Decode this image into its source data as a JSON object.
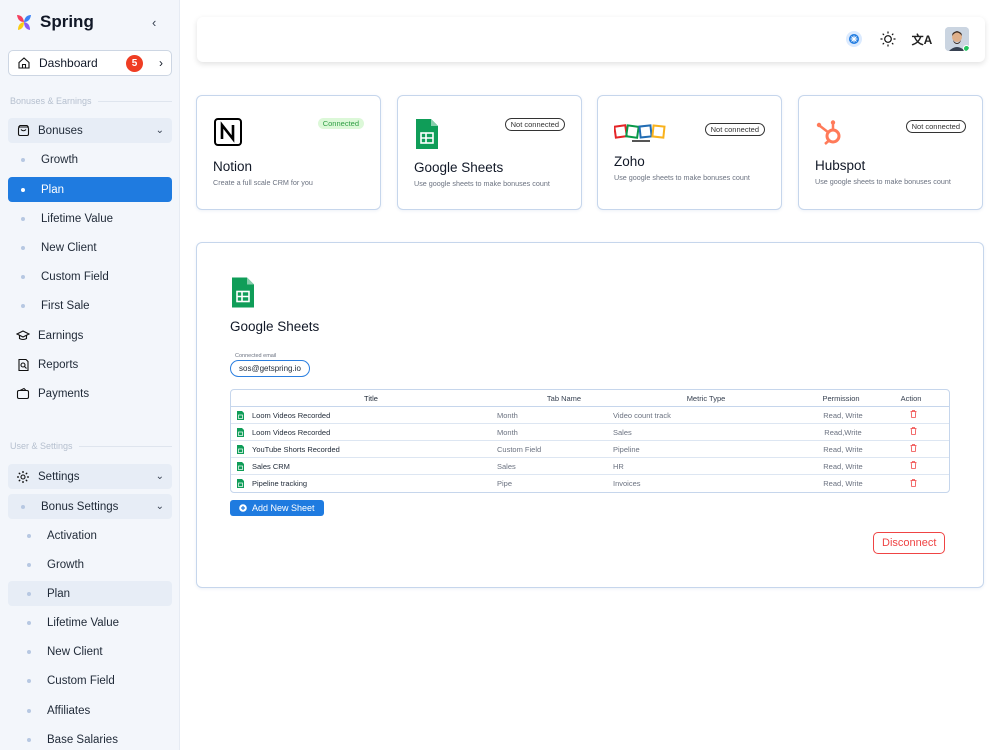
{
  "brand": {
    "name": "Spring",
    "collapse_glyph": "‹"
  },
  "sidebar": {
    "dashboard": {
      "label": "Dashboard",
      "badge": "5",
      "chevron": "›"
    },
    "section_bonuses": "Bonuses & Earnings",
    "bonuses_group": {
      "label": "Bonuses",
      "chevron": "⌄"
    },
    "bonuses_items": [
      "Growth",
      "Plan",
      "Lifetime Value",
      "New Client",
      "Custom Field",
      "First Sale"
    ],
    "earnings": "Earnings",
    "reports": "Reports",
    "payments": "Payments",
    "section_user": "User & Settings",
    "settings_group": {
      "label": "Settings",
      "chevron": "⌄"
    },
    "bonus_settings": {
      "label": "Bonus Settings",
      "chevron": "⌄"
    },
    "bonus_settings_items": [
      "Activation",
      "Growth",
      "Plan",
      "Lifetime Value",
      "New Client",
      "Custom Field",
      "Affiliates",
      "Base Salaries"
    ]
  },
  "topbar": {
    "translate_glyph": "文A"
  },
  "integrations": [
    {
      "name": "Notion",
      "description": "Create a full scale CRM for you",
      "status": "Connected"
    },
    {
      "name": "Google Sheets",
      "description": "Use google sheets to make bonuses count",
      "status": "Not connected"
    },
    {
      "name": "Zoho",
      "description": "Use google sheets to make bonuses count",
      "status": "Not connected"
    },
    {
      "name": "Hubspot",
      "description": "Use google sheets to make bonuses count",
      "status": "Not connected"
    }
  ],
  "panel": {
    "title": "Google Sheets",
    "email_label": "Connected email",
    "email": "sos@getspring.io",
    "columns": {
      "title": "Title",
      "tab": "Tab Name",
      "metric": "Metric Type",
      "permission": "Permission",
      "action": "Action"
    },
    "rows": [
      {
        "title": "Loom Videos Recorded",
        "tab": "Month",
        "metric": "Video count track",
        "permission": "Read, Write"
      },
      {
        "title": "Loom Videos Recorded",
        "tab": "Month",
        "metric": "Sales",
        "permission": "Read,Write"
      },
      {
        "title": "YouTube Shorts Recorded",
        "tab": "Custom Field",
        "metric": "Pipeline",
        "permission": "Read, Write"
      },
      {
        "title": "Sales CRM",
        "tab": "Sales",
        "metric": "HR",
        "permission": "Read, Write"
      },
      {
        "title": "Pipeline tracking",
        "tab": "Pipe",
        "metric": "Invoices",
        "permission": "Read, Write"
      }
    ],
    "add_button": "Add New Sheet",
    "disconnect_button": "Disconnect"
  },
  "colors": {
    "accent": "#1f7be0",
    "danger": "#ef4444",
    "badge": "#ef3d23",
    "connected": "#2f9e44"
  }
}
